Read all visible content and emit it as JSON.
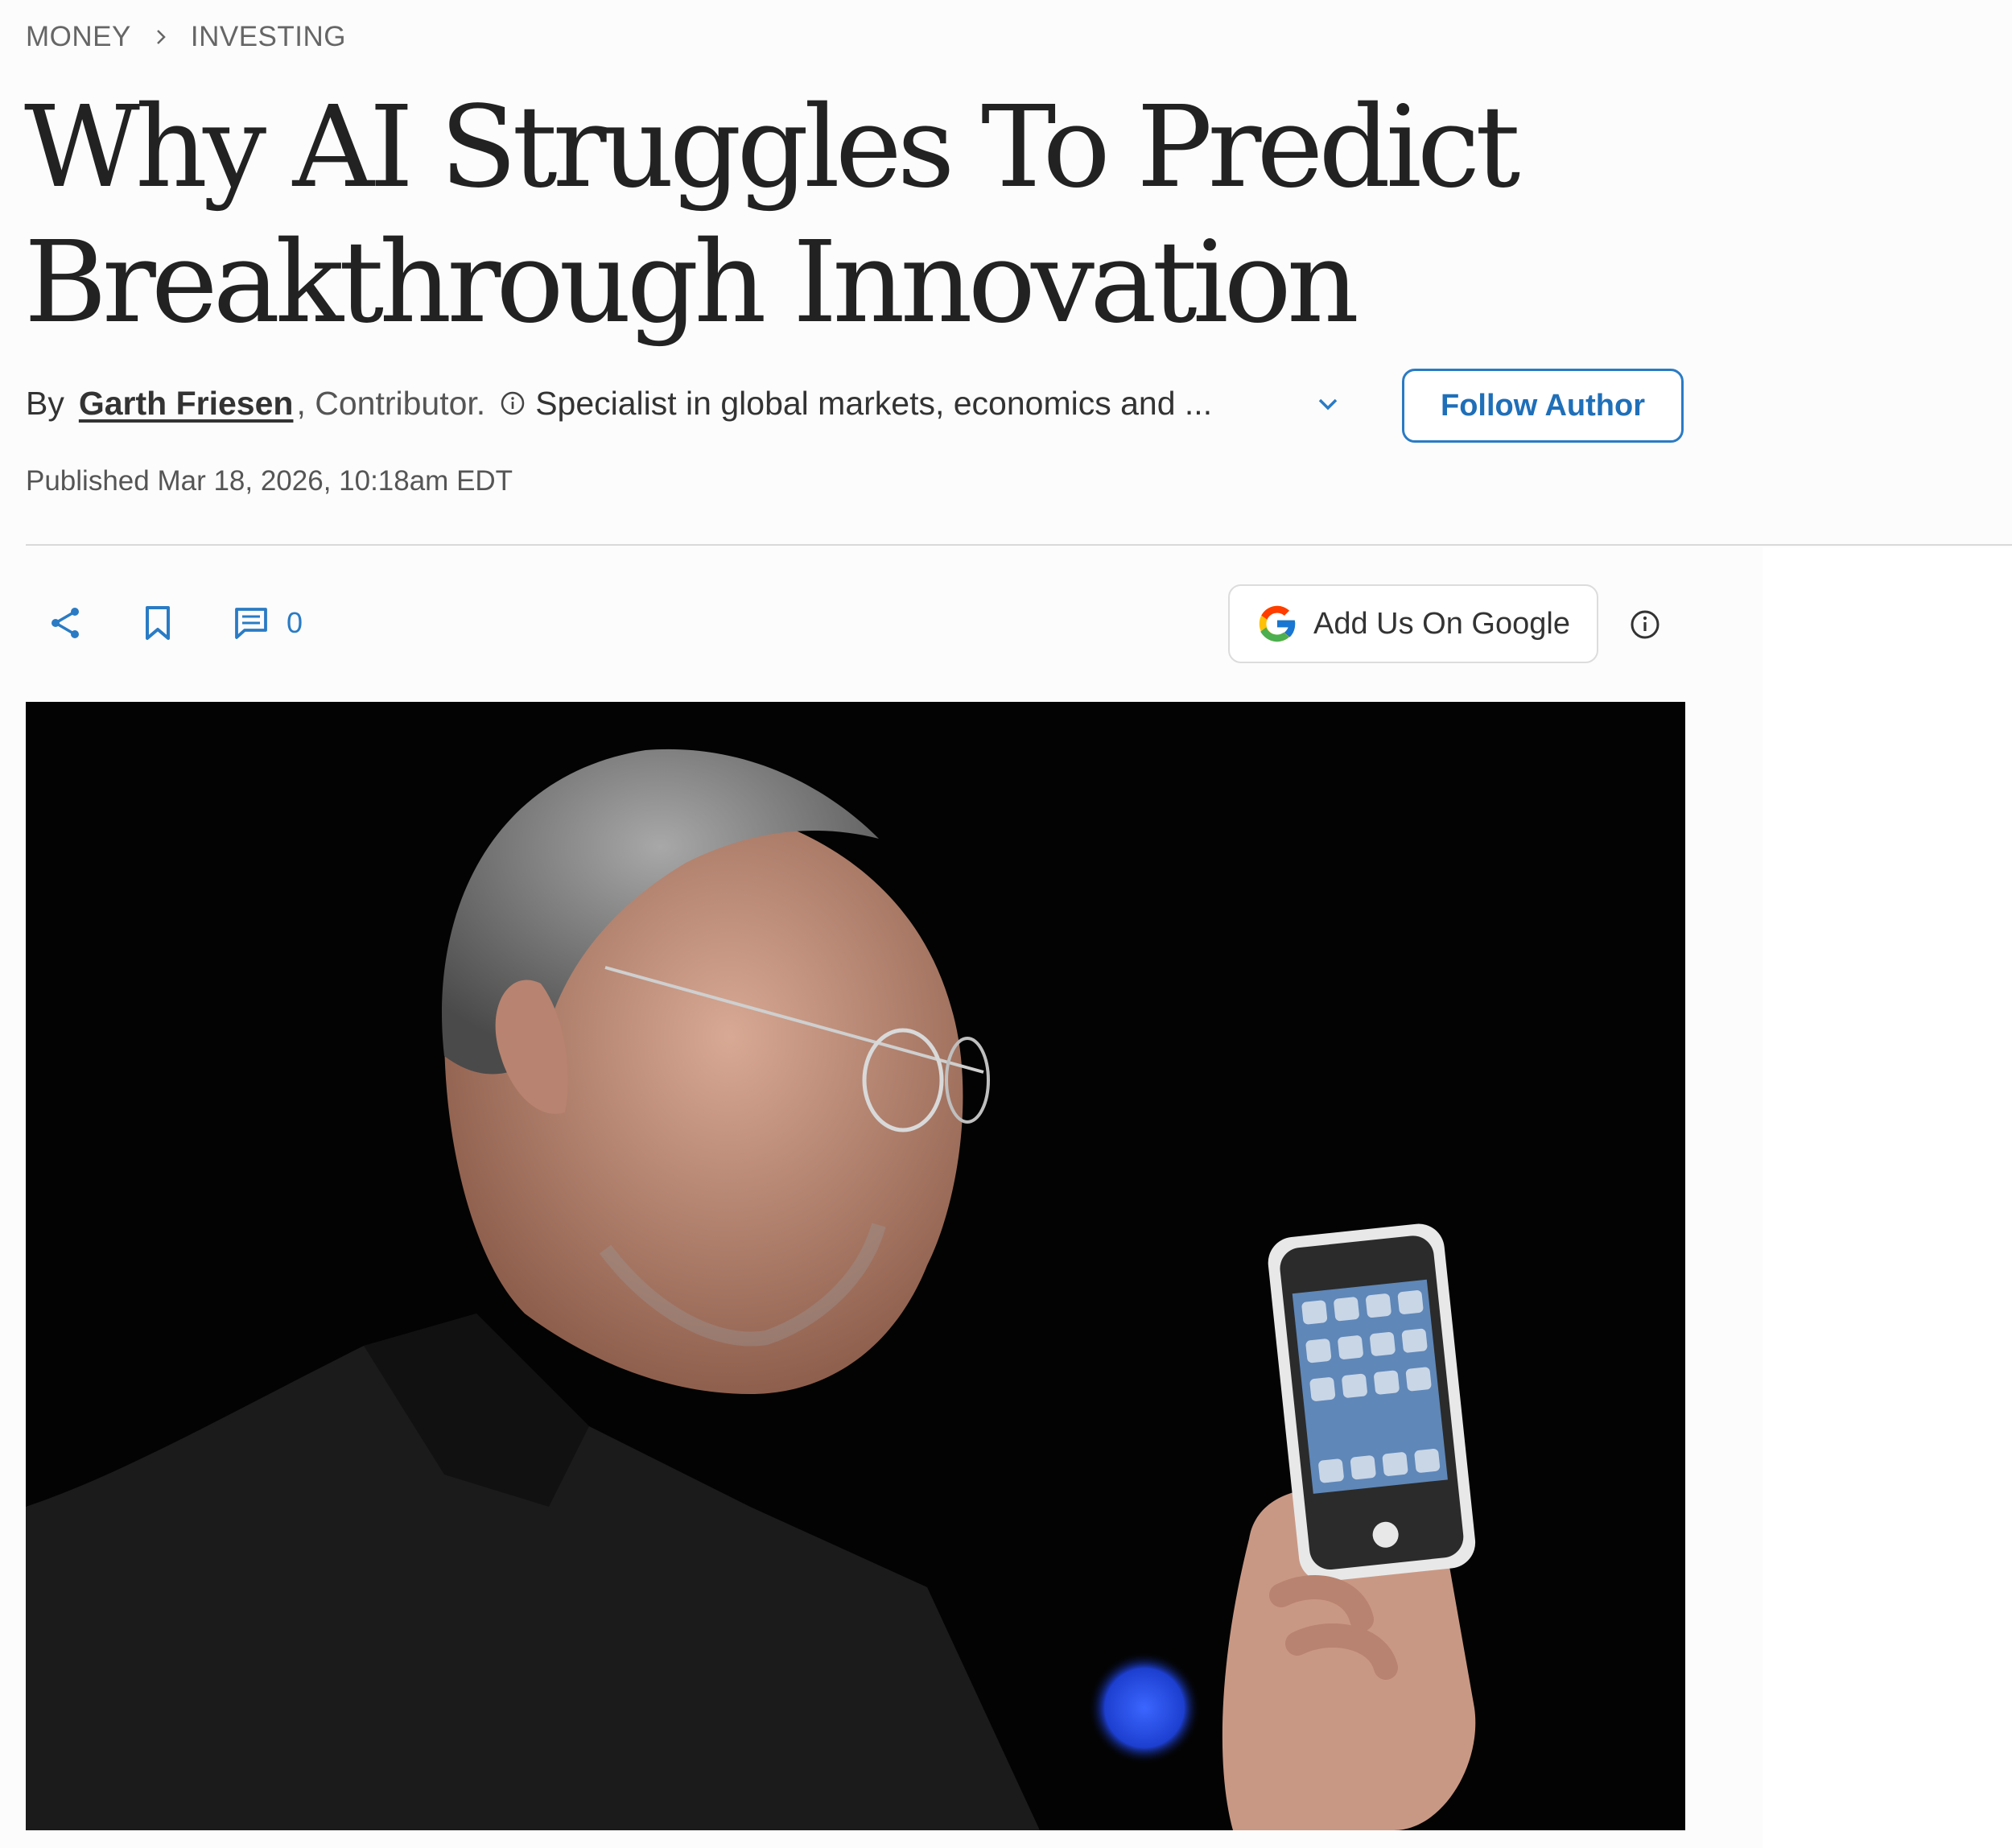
{
  "breadcrumb": {
    "section": "MONEY",
    "subsection": "INVESTING"
  },
  "article": {
    "title": "Why AI Struggles To Predict Breakthrough Innovation",
    "by_label": "By",
    "author": "Garth Friesen",
    "role": ", Contributor.",
    "bio": "Specialist in global markets, economics and ...",
    "follow_label": "Follow Author",
    "published": "Published Mar 18, 2026, 10:18am EDT"
  },
  "toolbar": {
    "comment_count": "0",
    "google_label": "Add Us On Google"
  },
  "colors": {
    "accent": "#2a7bc4",
    "text": "#222222",
    "divider": "#d9d9d9"
  },
  "icons": [
    "chevron-right-icon",
    "info-icon",
    "chevron-down-icon",
    "share-icon",
    "bookmark-icon",
    "comment-icon",
    "google-icon"
  ]
}
